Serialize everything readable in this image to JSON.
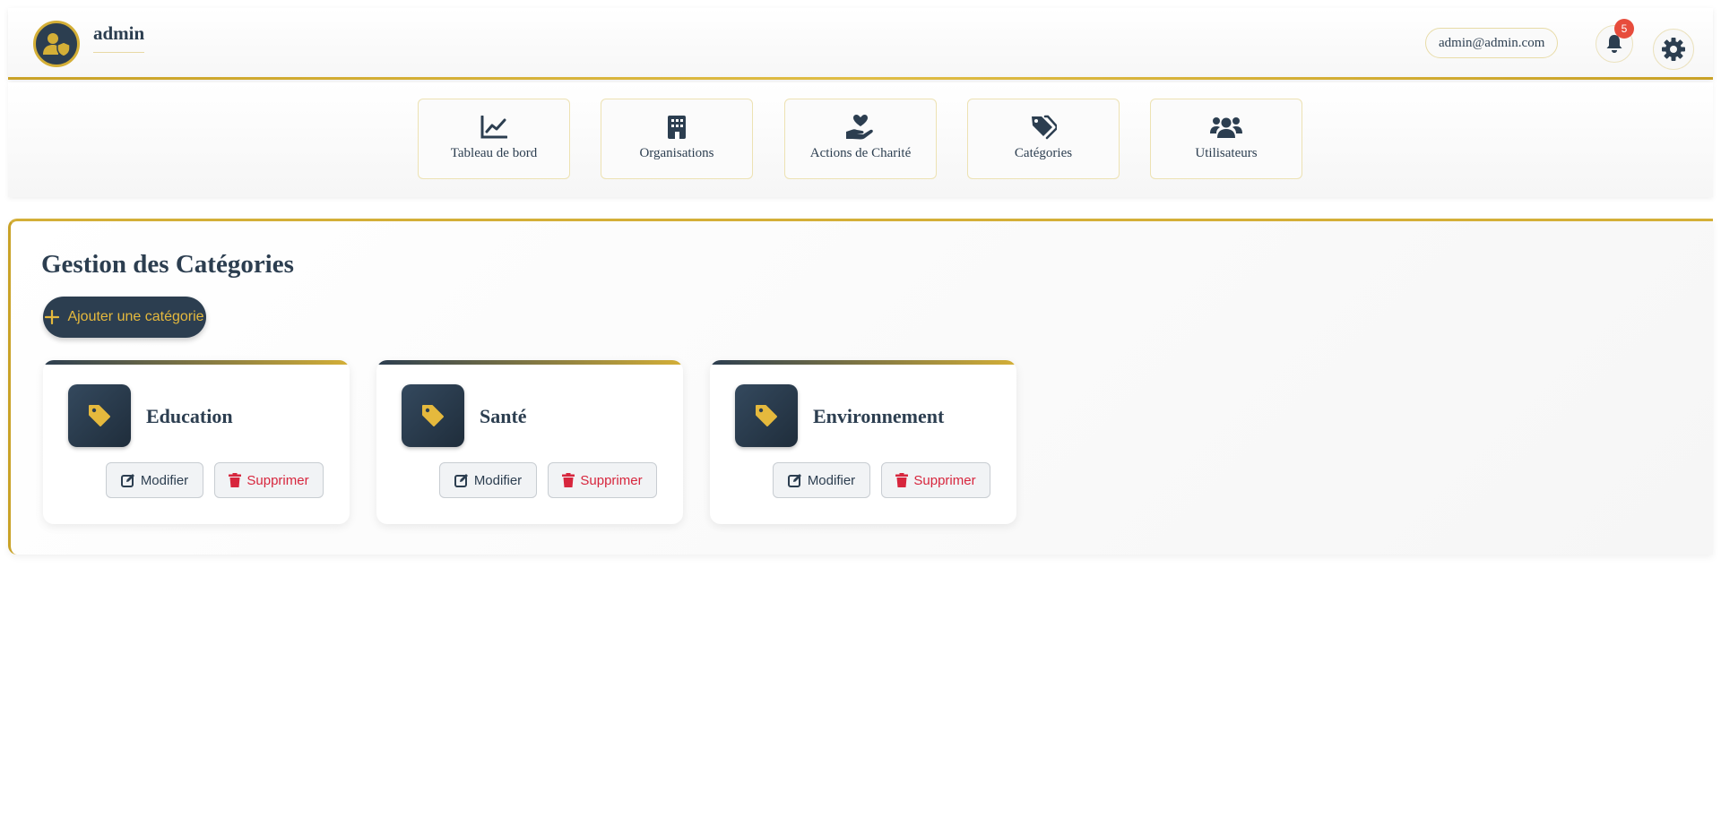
{
  "header": {
    "username": "admin",
    "email": "admin@admin.com",
    "notification_count": "5",
    "colors": {
      "accent": "#d4af37",
      "primary": "#2c3e50",
      "danger": "#d7263d",
      "badge": "#e74c3c"
    }
  },
  "nav": {
    "items": [
      {
        "label": "Tableau de bord",
        "icon": "chart-line-icon"
      },
      {
        "label": "Organisations",
        "icon": "building-icon"
      },
      {
        "label": "Actions de Charité",
        "icon": "hand-holding-heart-icon"
      },
      {
        "label": "Catégories",
        "icon": "tags-icon"
      },
      {
        "label": "Utilisateurs",
        "icon": "users-icon"
      }
    ]
  },
  "main": {
    "title": "Gestion des Catégories",
    "add_button_label": "Ajouter une catégorie",
    "categories": [
      {
        "name": "Education",
        "icon": "tag-icon"
      },
      {
        "name": "Santé",
        "icon": "tag-icon"
      },
      {
        "name": "Environnement",
        "icon": "tag-icon"
      }
    ],
    "edit_label": "Modifier",
    "delete_label": "Supprimer"
  }
}
